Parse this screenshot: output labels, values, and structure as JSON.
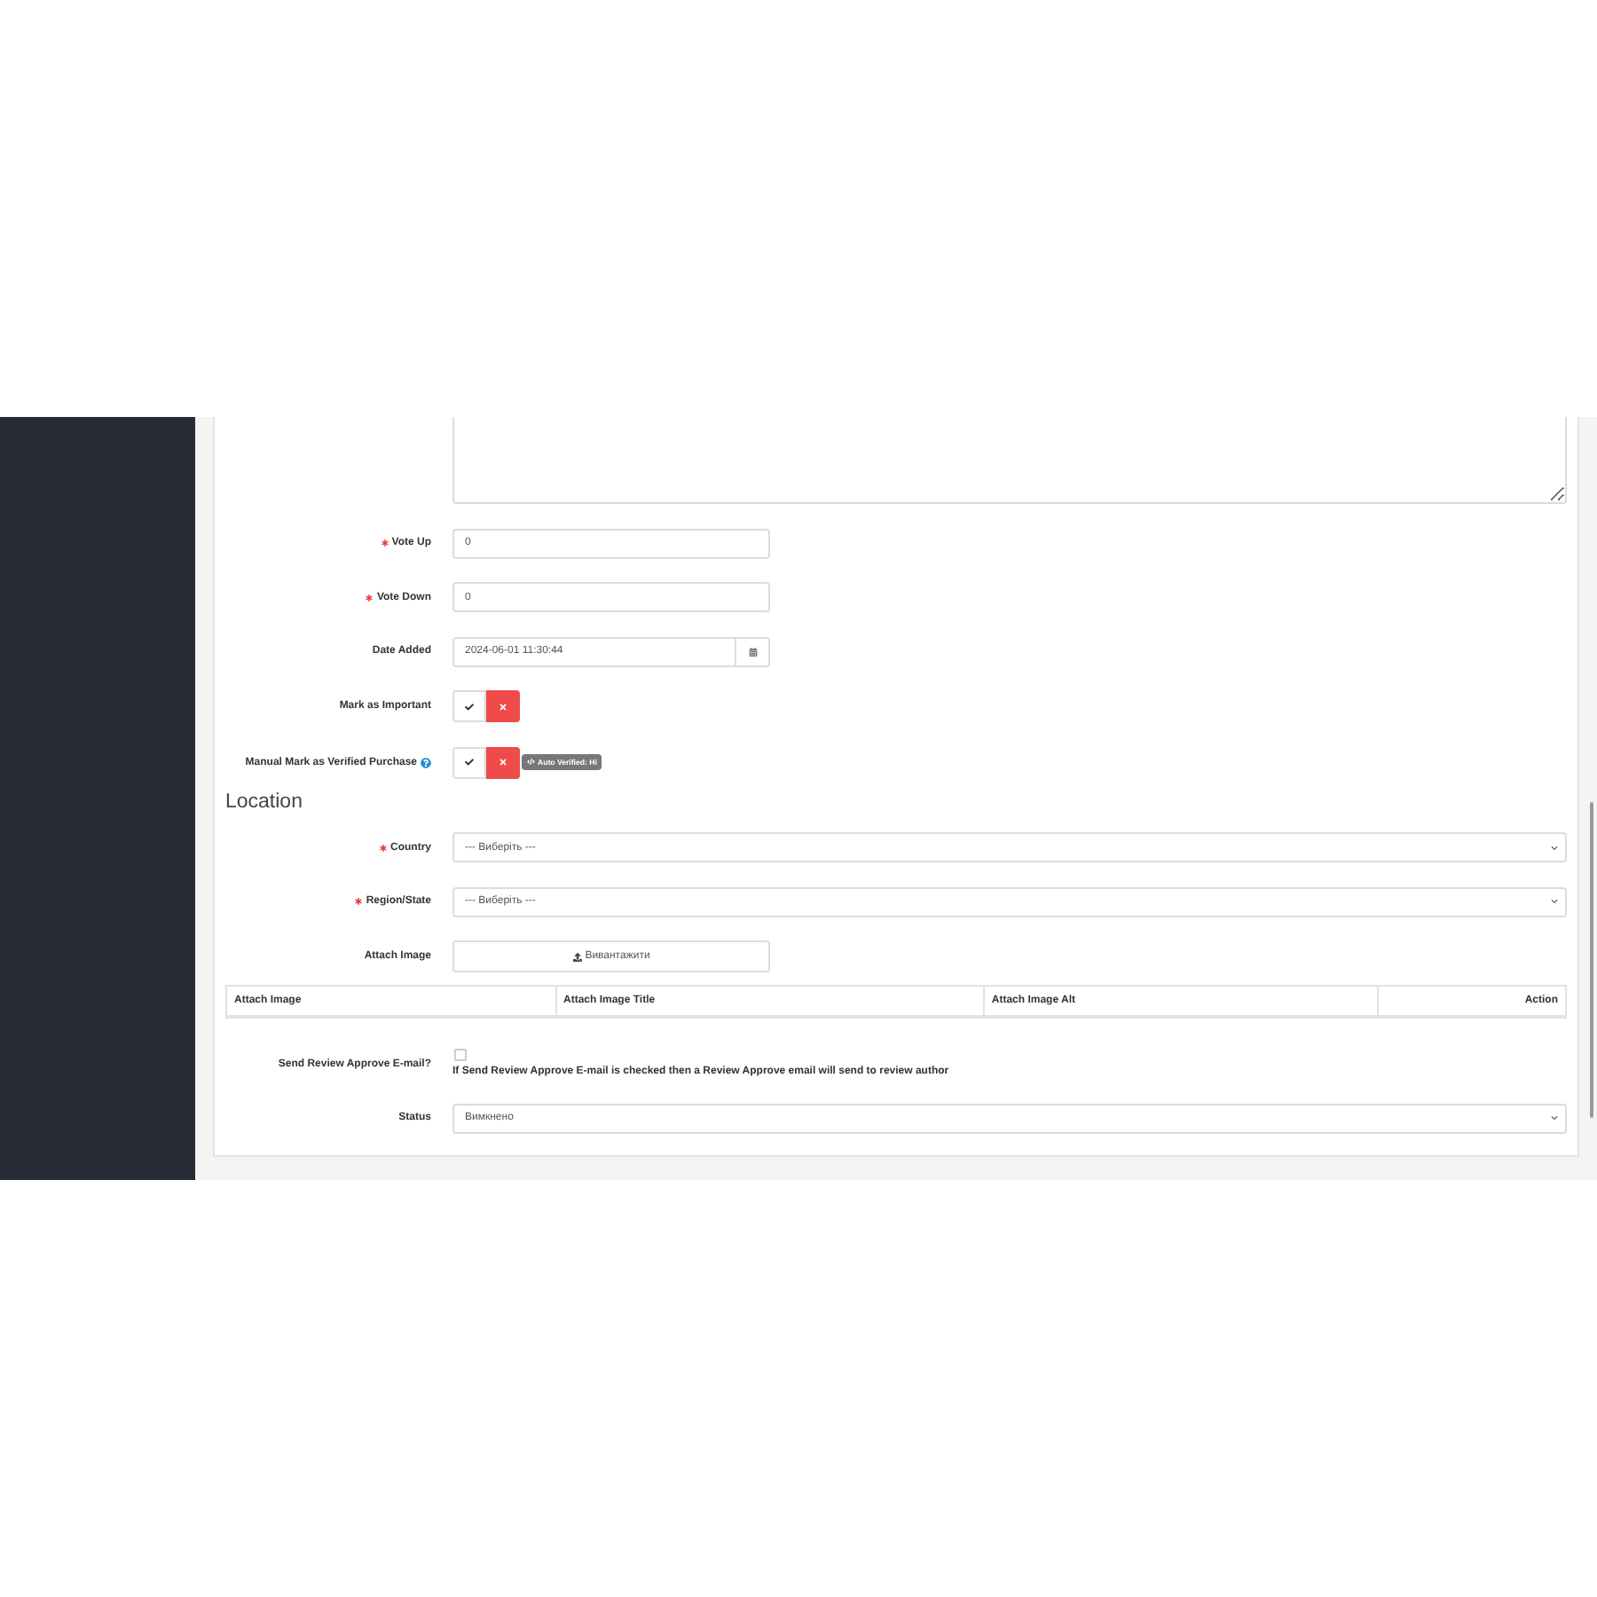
{
  "form": {
    "rows": [
      {
        "kind": "textarea"
      },
      {
        "kind": "text",
        "label": "Vote Up",
        "required": true,
        "value": "0"
      },
      {
        "kind": "text",
        "label": "Vote Down",
        "required": true,
        "value": "0"
      },
      {
        "kind": "date",
        "label": "Date Added",
        "value": "2024-06-01 11:30:44"
      },
      {
        "kind": "toggle",
        "label": "Mark as Important",
        "on": false
      },
      {
        "kind": "toggle",
        "label": "Manual Mark as Verified Purchase",
        "help": true,
        "on": false,
        "badge": "Auto Verified: Hi"
      },
      {
        "kind": "heading",
        "label": "Location"
      },
      {
        "kind": "select",
        "label": "Country",
        "required": true,
        "value": "--- Виберіть ---"
      },
      {
        "kind": "select",
        "label": "Region/State",
        "required": true,
        "value": "--- Виберіть ---"
      },
      {
        "kind": "upload",
        "label": "Attach Image",
        "button": "Вивантажити"
      },
      {
        "kind": "table",
        "columns": [
          "Attach Image",
          "Attach Image Title",
          "Attach Image Alt",
          "Action"
        ]
      },
      {
        "kind": "checkbox",
        "label": "Send Review Approve E-mail?",
        "checked": false,
        "note": "If Send Review Approve E-mail is checked then a Review Approve email will send to review author"
      },
      {
        "kind": "select",
        "label": "Status",
        "value": "Вимкнено"
      }
    ]
  }
}
